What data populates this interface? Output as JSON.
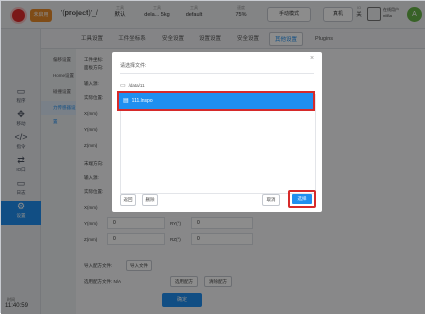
{
  "header": {
    "state_label": "未启用",
    "user_text": "'(𝐩𝐫𝐨𝐣𝐞𝐜𝐭)'_/",
    "status": [
      {
        "label": "工具",
        "value": "默认"
      },
      {
        "label": "工具",
        "value": "dela... 5kg"
      },
      {
        "label": "工具",
        "value": "default"
      },
      {
        "label": "速度",
        "value": "75%"
      }
    ],
    "mode_button": "手动模式",
    "machine_button": "真机",
    "io_label": "IO",
    "io_status": "关",
    "account_label": "在线用户",
    "account_name": "nilBa",
    "avatar_letter": "A"
  },
  "sidebar": {
    "items": [
      {
        "icon": "▭",
        "label": "程序"
      },
      {
        "icon": "✥",
        "label": "移动"
      },
      {
        "icon": "</>",
        "label": "指令"
      },
      {
        "icon": "⇄",
        "label": "IO口"
      },
      {
        "icon": "▭",
        "label": "日志"
      },
      {
        "icon": "⚙",
        "label": "设置"
      }
    ],
    "clock_label": "时间",
    "clock": "11:40:59"
  },
  "tabs": [
    {
      "label": "工具设置"
    },
    {
      "label": "工件坐标系"
    },
    {
      "label": "安全设置"
    },
    {
      "label": "设置设置"
    },
    {
      "label": "安全设置"
    },
    {
      "label": "其他设置"
    },
    {
      "label": "Plugins"
    }
  ],
  "subnav": [
    {
      "label": "偏移设置"
    },
    {
      "label": "Home设置"
    },
    {
      "label": "碰撞设置"
    },
    {
      "label": "力传感器设置"
    }
  ],
  "content": {
    "rows": [
      {
        "label": "工件坐标:"
      },
      {
        "label": "面板方向:"
      },
      {
        "label": "输入源:"
      },
      {
        "label": "实际位置:"
      },
      {
        "label": "X(mm)"
      },
      {
        "label": "Y(mm)"
      },
      {
        "label": "Z(mm)"
      },
      {
        "label": "末端方向:"
      },
      {
        "label": "输入源:"
      },
      {
        "label": "实际位置:"
      },
      {
        "label": "X(mm)"
      }
    ],
    "grid": [
      {
        "label": "Y(mm)",
        "value": "0",
        "label2": "RY(°)",
        "value2": "0"
      },
      {
        "label": "Z(mm)",
        "value": "0",
        "label2": "RZ(°)",
        "value2": "0"
      }
    ],
    "import_label": "导入配方文件:",
    "import_button": "导入文件",
    "applied_label": "选用配方文件: N/A",
    "apply_button": "选用配方",
    "clear_button": "清除配方",
    "confirm_button": "确定"
  },
  "dialog": {
    "title": "请选择文件:",
    "close_icon": "×",
    "directory": "/data/11",
    "file_selected": "111.lnspo",
    "back_button": "返回",
    "delete_button": "删除",
    "cancel_button": "取消",
    "select_button": "选择"
  },
  "colors": {
    "accent": "#1f8ff0",
    "highlight_border": "#d62a2a",
    "active_avatar": "#67b347"
  }
}
